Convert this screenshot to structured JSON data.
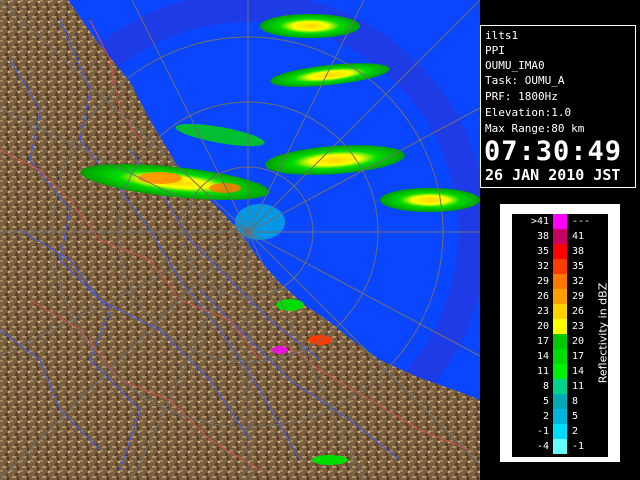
{
  "info": {
    "site": "ilts1",
    "product": "PPI",
    "radar_id": "OUMU_IMA0",
    "task": "Task: OUMU_A",
    "prf": "PRF: 1800Hz",
    "elevation": "Elevation:1.0",
    "max_range": "Max Range:80 km",
    "time": "07:30:49",
    "date": "26 JAN 2010 JST"
  },
  "legend": {
    "unit_label": "Reflectivity in dBZ",
    "bins": [
      {
        "low": ">41",
        "high": "---",
        "color": "#ff00ff"
      },
      {
        "low": "38",
        "high": "41",
        "color": "#c80064"
      },
      {
        "low": "35",
        "high": "38",
        "color": "#ff0000"
      },
      {
        "low": "32",
        "high": "35",
        "color": "#ff3c00"
      },
      {
        "low": "29",
        "high": "32",
        "color": "#ff7800"
      },
      {
        "low": "26",
        "high": "29",
        "color": "#ffa000"
      },
      {
        "low": "23",
        "high": "26",
        "color": "#ffd200"
      },
      {
        "low": "20",
        "high": "23",
        "color": "#ffff00"
      },
      {
        "low": "17",
        "high": "20",
        "color": "#00c800"
      },
      {
        "low": "14",
        "high": "17",
        "color": "#00dc00"
      },
      {
        "low": "11",
        "high": "14",
        "color": "#00f000"
      },
      {
        "low": "8",
        "high": "11",
        "color": "#00d28c"
      },
      {
        "low": "5",
        "high": "8",
        "color": "#00aab4"
      },
      {
        "low": "2",
        "high": "5",
        "color": "#00b4dc"
      },
      {
        "low": "-1",
        "high": "2",
        "color": "#00dcff"
      },
      {
        "low": "-4",
        "high": "-1",
        "color": "#64ffff"
      }
    ]
  },
  "colors": {
    "sea": "#0a46ff",
    "land": "#7a6040",
    "rings": "#6e6e6e",
    "rivers": "#3c5cff",
    "borders": "#d25050"
  }
}
